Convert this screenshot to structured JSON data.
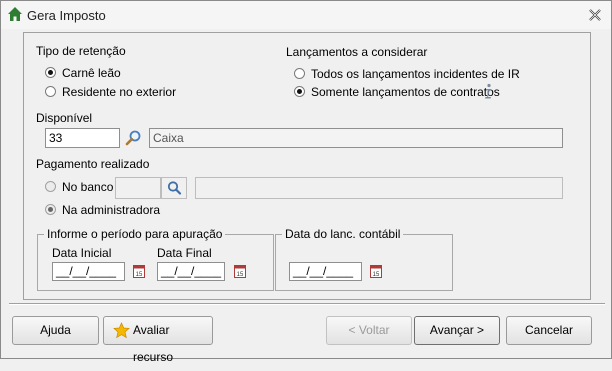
{
  "window": {
    "title": "Gera Imposto"
  },
  "tipo_retencao": {
    "label": "Tipo de retenção",
    "options": [
      {
        "label": "Carnê leão",
        "selected": true
      },
      {
        "label": "Residente no exterior",
        "selected": false
      }
    ]
  },
  "lancamentos": {
    "label": "Lançamentos a considerar",
    "options": [
      {
        "label": "Todos os lançamentos incidentes de IR",
        "selected": false
      },
      {
        "label": "Somente lançamentos de contratos",
        "selected": true
      }
    ],
    "info_icon": "info-icon"
  },
  "disponivel": {
    "label": "Disponível",
    "code": "33",
    "description": "Caixa"
  },
  "pagamento": {
    "label": "Pagamento realizado",
    "options": [
      {
        "label": "No banco",
        "selected": false
      },
      {
        "label": "Na administradora",
        "selected": true
      }
    ],
    "banco_code": "",
    "banco_description": ""
  },
  "periodo": {
    "label": "Informe o período para apuração",
    "data_inicial_label": "Data Inicial",
    "data_inicial_value": "__/__/____",
    "data_final_label": "Data Final",
    "data_final_value": "__/__/____"
  },
  "contabil": {
    "label": "Data do lanc. contábil",
    "value": "__/__/____"
  },
  "buttons": {
    "ajuda": "Ajuda",
    "avaliar": "Avaliar recurso",
    "voltar": "< Voltar",
    "avancar": "Avançar >",
    "cancelar": "Cancelar"
  },
  "colors": {
    "title_icon": "#2e7d32",
    "star": "#f5b700",
    "calendar": "#b03a3a"
  }
}
